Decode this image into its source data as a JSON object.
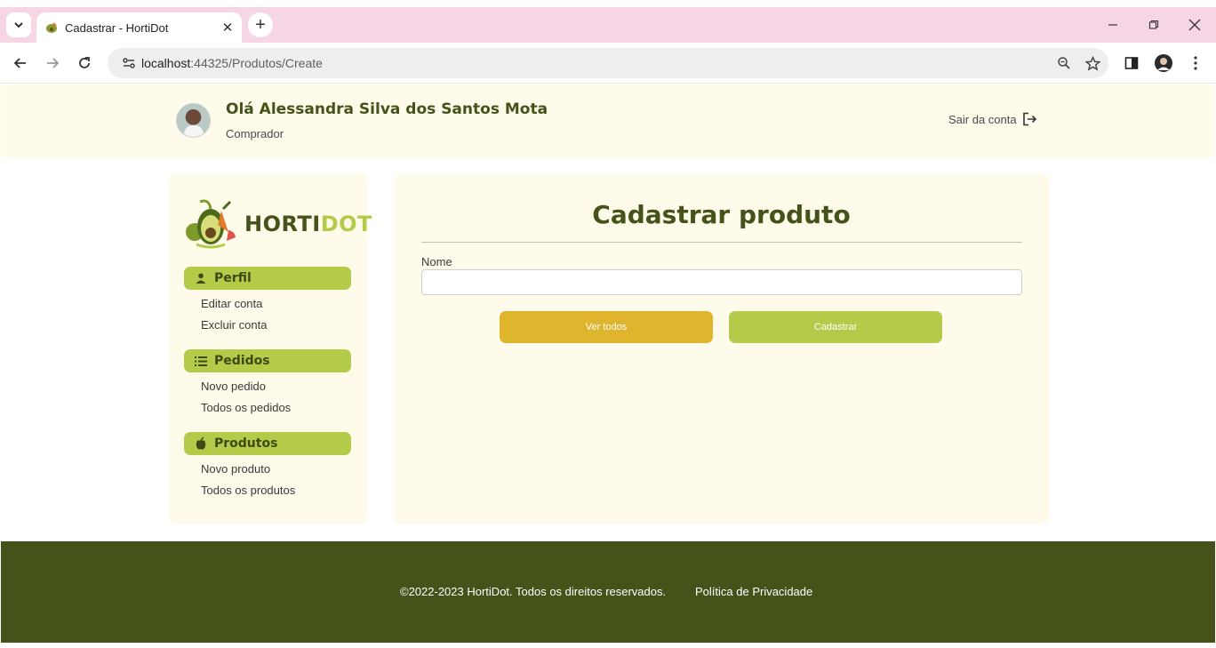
{
  "browser": {
    "tab_title": "Cadastrar - HortiDot",
    "url_host": "localhost",
    "url_rest": ":44325/Produtos/Create"
  },
  "header": {
    "greeting": "Olá Alessandra Silva dos Santos Mota",
    "role": "Comprador",
    "logout_label": "Sair da conta"
  },
  "sidebar": {
    "logo_part1": "HORTI",
    "logo_part2": "DOT",
    "sections": [
      {
        "title": "Perfil",
        "icon": "person-icon",
        "links": [
          "Editar conta",
          "Excluir conta"
        ]
      },
      {
        "title": "Pedidos",
        "icon": "list-icon",
        "links": [
          "Novo pedido",
          "Todos os pedidos"
        ]
      },
      {
        "title": "Produtos",
        "icon": "apple-icon",
        "links": [
          "Novo produto",
          "Todos os produtos"
        ]
      }
    ]
  },
  "form": {
    "title": "Cadastrar produto",
    "name_label": "Nome",
    "name_value": "",
    "view_all_label": "Ver todos",
    "submit_label": "Cadastrar"
  },
  "footer": {
    "copyright": "©2022-2023 HortiDot. Todos os direitos reservados.",
    "privacy_link": "Política de Privacidade"
  },
  "colors": {
    "brand_dark": "#45521a",
    "brand_green": "#b3cb48",
    "brand_yellow": "#dfb52e",
    "panel_bg": "#fefbea"
  }
}
